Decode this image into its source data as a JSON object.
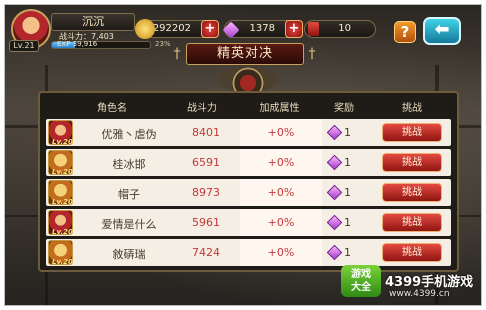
{
  "player": {
    "level": "Lv.21",
    "name": "沉沉",
    "power_text": "战斗力：7,403",
    "exp_text": "EXP 39,916",
    "exp_percent": "23%",
    "exp_fraction": 0.23
  },
  "resources": {
    "gold": "292202",
    "gems": "1378",
    "cards": "10"
  },
  "title": "精英对决",
  "table": {
    "headers": [
      "角色名",
      "战斗力",
      "加成属性",
      "奖励",
      "挑战"
    ],
    "rows": [
      {
        "level": "Lv.20",
        "name": "优雅丶虐伪",
        "power": "8401",
        "bonus": "+0%",
        "reward": "1",
        "button": "挑战",
        "avatar": "red"
      },
      {
        "level": "Lv.20",
        "name": "桂冰邯",
        "power": "6591",
        "bonus": "+0%",
        "reward": "1",
        "button": "挑战",
        "avatar": "gold"
      },
      {
        "level": "Lv.20",
        "name": "帽子",
        "power": "8973",
        "bonus": "+0%",
        "reward": "1",
        "button": "挑战",
        "avatar": "gold"
      },
      {
        "level": "Lv.20",
        "name": "爱情是什么",
        "power": "5961",
        "bonus": "+0%",
        "reward": "1",
        "button": "挑战",
        "avatar": "red"
      },
      {
        "level": "Lv.20",
        "name": "敘硦瑞",
        "power": "7424",
        "bonus": "+0%",
        "reward": "1",
        "button": "挑战",
        "avatar": "gold"
      }
    ]
  },
  "icons": {
    "help": "?",
    "back": "arrow-left-icon"
  },
  "watermark": {
    "logo": "游戏大全",
    "site": "4399手机游戏",
    "url": "www.4399.cn"
  }
}
